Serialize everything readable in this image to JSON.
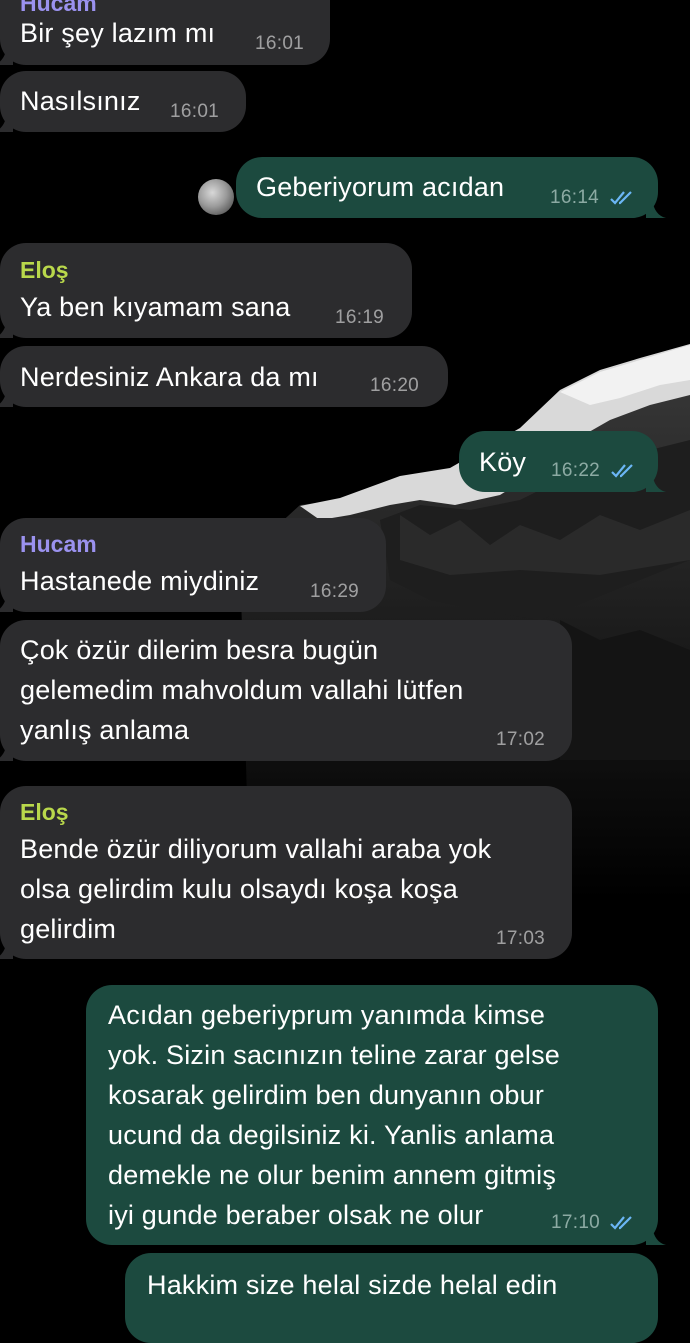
{
  "colors": {
    "sender_hucam": "#9b92ef",
    "sender_elos": "#b9d84b",
    "check_blue": "#6bb6f5"
  },
  "partial_header": "Hucam",
  "messages": [
    {
      "text": "Bir şey lazım mı",
      "time": "16:01"
    },
    {
      "text": "Nasılsınız",
      "time": "16:01"
    },
    {
      "text": "Geberiyorum acıdan",
      "time": "16:14",
      "status_icon": "double-check-icon"
    },
    {
      "sender": "Eloş",
      "text": "Ya ben kıyamam sana",
      "time": "16:19"
    },
    {
      "text": "Nerdesiniz Ankara da mı",
      "time": "16:20"
    },
    {
      "text": "Köy",
      "time": "16:22",
      "status_icon": "double-check-icon"
    },
    {
      "sender": "Hucam",
      "text": "Hastanede miydiniz",
      "time": "16:29"
    },
    {
      "lines": [
        "Çok özür dilerim besra bugün",
        "gelemedim mahvoldum vallahi lütfen",
        "yanlış anlama"
      ],
      "time": "17:02"
    },
    {
      "sender": "Eloş",
      "lines": [
        "Bende özür diliyorum vallahi araba yok",
        "olsa gelirdim kulu olsaydı koşa koşa",
        "gelirdim"
      ],
      "time": "17:03"
    },
    {
      "lines": [
        "Acıdan geberiyprum yanımda kimse",
        "yok. Sizin sacınızın teline zarar gelse",
        "kosarak gelirdim ben dunyanın obur",
        "ucund da degilsiniz ki. Yanlis anlama",
        "demekle ne olur benim annem gitmiş",
        "iyi gunde beraber olsak ne olur"
      ],
      "time": "17:10",
      "status_icon": "double-check-icon"
    },
    {
      "text": "Hakkim size helal sizde helal edin"
    }
  ]
}
